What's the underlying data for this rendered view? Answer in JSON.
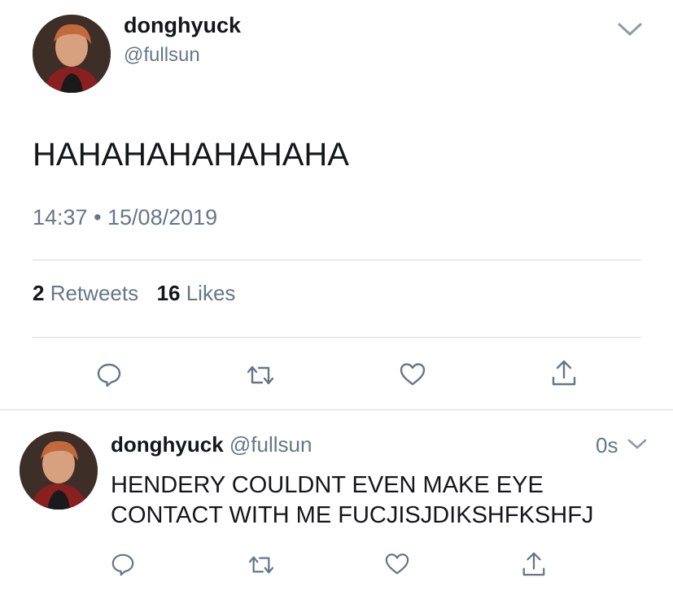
{
  "main_tweet": {
    "author_name": "donghyuck",
    "author_handle": "@fullsun",
    "text": "HAHAHAHAHAHAHA",
    "timestamp": "14:37 • 15/08/2019",
    "stats": {
      "retweets_count": "2",
      "retweets_label": "Retweets",
      "likes_count": "16",
      "likes_label": "Likes"
    },
    "actions": [
      "reply-icon",
      "retweet-icon",
      "like-icon",
      "share-icon"
    ]
  },
  "reply_tweet": {
    "author_name": "donghyuck",
    "author_handle": "@fullsun",
    "time": "0s",
    "text_line1": "HENDERY COULDNT EVEN MAKE EYE",
    "text_line2": "CONTACT WITH ME FUCJISJDIKSHFKSHFJ",
    "actions": [
      "reply-icon",
      "retweet-icon",
      "like-icon",
      "share-icon"
    ]
  },
  "colors": {
    "text": "#14171a",
    "muted": "#657786",
    "divider": "#d6dbdf",
    "icon": "#657786"
  }
}
